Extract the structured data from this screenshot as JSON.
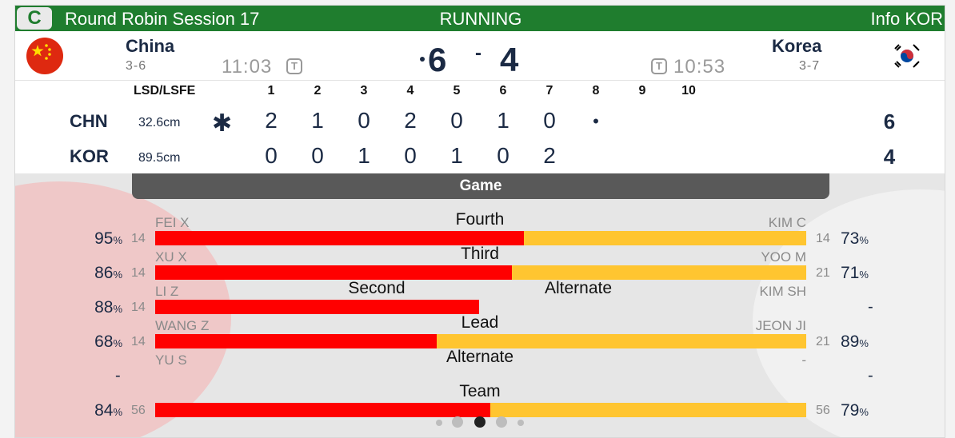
{
  "header": {
    "badge": "C",
    "session": "Round Robin Session 17",
    "status": "RUNNING",
    "info": "Info KOR"
  },
  "teams": {
    "left": {
      "name": "China",
      "code": "CHN",
      "record": "3-6",
      "clock": "11:03",
      "timeout": "T",
      "score": "6",
      "lsd": "32.6cm",
      "total": "6",
      "flag_icon": "china-flag-icon"
    },
    "right": {
      "name": "Korea",
      "code": "KOR",
      "record": "3-7",
      "clock": "10:53",
      "timeout": "T",
      "score": "4",
      "lsd": "89.5cm",
      "total": "4",
      "flag_icon": "korea-flag-icon"
    },
    "separator": "-"
  },
  "linescore": {
    "lsd_header": "LSD/LSFE",
    "ends": [
      "1",
      "2",
      "3",
      "4",
      "5",
      "6",
      "7",
      "8",
      "9",
      "10"
    ],
    "chn": [
      "2",
      "1",
      "0",
      "2",
      "0",
      "1",
      "0"
    ],
    "kor": [
      "0",
      "0",
      "1",
      "0",
      "1",
      "0",
      "2"
    ],
    "chn_star": "✱",
    "current_end_marker": "•"
  },
  "stats": {
    "tab": "Game",
    "rows": [
      {
        "position": "Fourth",
        "left_player": "FEI X",
        "left_count": "14",
        "left_pct": "95",
        "right_player": "KIM C",
        "right_count": "14",
        "right_pct": "73",
        "red_fraction": 0.566
      },
      {
        "position": "Third",
        "left_player": "XU X",
        "left_count": "14",
        "left_pct": "86",
        "right_player": "YOO M",
        "right_count": "21",
        "right_pct": "71",
        "red_fraction": 0.548
      },
      {
        "position_left": "Second",
        "position_right": "Alternate",
        "left_player": "LI Z",
        "left_count": "14",
        "left_pct": "88",
        "right_player": "KIM SH",
        "right_value": "-",
        "red_fraction": 0.498
      },
      {
        "position": "Lead",
        "left_player": "WANG Z",
        "left_count": "14",
        "left_pct": "68",
        "right_player": "JEON JI",
        "right_count": "21",
        "right_pct": "89",
        "red_fraction": 0.433
      },
      {
        "position": "Alternate",
        "left_player": "YU S",
        "left_value": "-",
        "right_player": "-",
        "right_value": "-"
      },
      {
        "position": "Team",
        "left_count": "56",
        "left_pct": "84",
        "right_count": "56",
        "right_pct": "79",
        "red_fraction": 0.515
      }
    ],
    "percent_sign": "%"
  }
}
